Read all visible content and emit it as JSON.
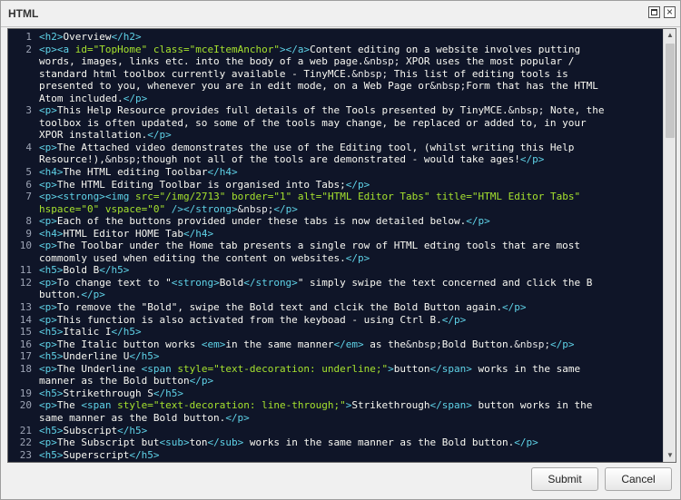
{
  "window": {
    "title": "HTML",
    "maximize_icon": "maximize-icon",
    "close_glyph": "×"
  },
  "buttons": {
    "submit": "Submit",
    "cancel": "Cancel"
  },
  "scrollbar": {
    "up": "▲",
    "down": "▼"
  },
  "code_lines": [
    {
      "n": "1",
      "seg": [
        [
          "t",
          "<h2>"
        ],
        [
          "x",
          "Overview"
        ],
        [
          "t",
          "</h2>"
        ]
      ]
    },
    {
      "n": "2",
      "seg": [
        [
          "t",
          "<p>"
        ],
        [
          "t",
          "<a "
        ],
        [
          "a",
          "id="
        ],
        [
          "v",
          "\"TopHome\""
        ],
        [
          "t",
          " "
        ],
        [
          "a",
          "class="
        ],
        [
          "v",
          "\"mceItemAnchor\""
        ],
        [
          "t",
          "></a>"
        ],
        [
          "x",
          "Content editing on a website involves putting"
        ]
      ]
    },
    {
      "n": "",
      "seg": [
        [
          "x",
          "words, images, links etc. into the body of a web page."
        ],
        [
          "e",
          "&nbsp;"
        ],
        [
          "x",
          " XPOR uses the most popular /"
        ]
      ]
    },
    {
      "n": "",
      "seg": [
        [
          "x",
          "standard html toolbox currently available - TinyMCE."
        ],
        [
          "e",
          "&nbsp;"
        ],
        [
          "x",
          " This list of editing tools is"
        ]
      ]
    },
    {
      "n": "",
      "seg": [
        [
          "x",
          "presented to you, whenever you are in edit mode, on a Web Page or"
        ],
        [
          "e",
          "&nbsp;"
        ],
        [
          "x",
          "Form that has the HTML"
        ]
      ]
    },
    {
      "n": "",
      "seg": [
        [
          "x",
          "Atom included."
        ],
        [
          "t",
          "</p>"
        ]
      ]
    },
    {
      "n": "3",
      "seg": [
        [
          "t",
          "<p>"
        ],
        [
          "x",
          "This Help Resource provides full details of the Tools presented by TinyMCE."
        ],
        [
          "e",
          "&nbsp;"
        ],
        [
          "x",
          " Note, the"
        ]
      ]
    },
    {
      "n": "",
      "seg": [
        [
          "x",
          "toolbox is often updated, so some of the tools may change, be replaced or added to, in your"
        ]
      ]
    },
    {
      "n": "",
      "seg": [
        [
          "x",
          "XPOR installation."
        ],
        [
          "t",
          "</p>"
        ]
      ]
    },
    {
      "n": "4",
      "seg": [
        [
          "t",
          "<p>"
        ],
        [
          "x",
          "The Attached video demonstrates the use of the Editing tool, (whilst writing this Help"
        ]
      ]
    },
    {
      "n": "",
      "seg": [
        [
          "x",
          "Resource!),"
        ],
        [
          "e",
          "&nbsp;"
        ],
        [
          "x",
          "though not all of the tools are demonstrated - would take ages!"
        ],
        [
          "t",
          "</p>"
        ]
      ]
    },
    {
      "n": "5",
      "seg": [
        [
          "t",
          "<h4>"
        ],
        [
          "x",
          "The HTML editing Toolbar"
        ],
        [
          "t",
          "</h4>"
        ]
      ]
    },
    {
      "n": "6",
      "seg": [
        [
          "t",
          "<p>"
        ],
        [
          "x",
          "The HTML Editing Toolbar is organised into Tabs;"
        ],
        [
          "t",
          "</p>"
        ]
      ]
    },
    {
      "n": "7",
      "seg": [
        [
          "t",
          "<p>"
        ],
        [
          "t",
          "<strong>"
        ],
        [
          "t",
          "<img "
        ],
        [
          "a",
          "src="
        ],
        [
          "v",
          "\"/img/2713\""
        ],
        [
          "t",
          " "
        ],
        [
          "a",
          "border="
        ],
        [
          "v",
          "\"1\""
        ],
        [
          "t",
          " "
        ],
        [
          "a",
          "alt="
        ],
        [
          "v",
          "\"HTML Editor Tabs\""
        ],
        [
          "t",
          " "
        ],
        [
          "a",
          "title="
        ],
        [
          "v",
          "\"HTML Editor Tabs\""
        ]
      ]
    },
    {
      "n": "",
      "seg": [
        [
          "a",
          "hspace="
        ],
        [
          "v",
          "\"0\""
        ],
        [
          "t",
          " "
        ],
        [
          "a",
          "vspace="
        ],
        [
          "v",
          "\"0\""
        ],
        [
          "t",
          " />"
        ],
        [
          "t",
          "</strong>"
        ],
        [
          "e",
          "&nbsp;"
        ],
        [
          "t",
          "</p>"
        ]
      ]
    },
    {
      "n": "8",
      "seg": [
        [
          "t",
          "<p>"
        ],
        [
          "x",
          "Each of the buttons provided under these tabs is now detailed below."
        ],
        [
          "t",
          "</p>"
        ]
      ]
    },
    {
      "n": "9",
      "seg": [
        [
          "t",
          "<h4>"
        ],
        [
          "x",
          "HTML Editor HOME Tab"
        ],
        [
          "t",
          "</h4>"
        ]
      ]
    },
    {
      "n": "10",
      "seg": [
        [
          "t",
          "<p>"
        ],
        [
          "x",
          "The Toolbar under the Home tab presents a single row of HTML edting tools that are most"
        ]
      ]
    },
    {
      "n": "",
      "seg": [
        [
          "x",
          "commomly used when editing the content on websites."
        ],
        [
          "t",
          "</p>"
        ]
      ]
    },
    {
      "n": "11",
      "seg": [
        [
          "t",
          "<h5>"
        ],
        [
          "x",
          "Bold B"
        ],
        [
          "t",
          "</h5>"
        ]
      ]
    },
    {
      "n": "12",
      "seg": [
        [
          "t",
          "<p>"
        ],
        [
          "x",
          "To change text to \""
        ],
        [
          "t",
          "<strong>"
        ],
        [
          "x",
          "Bold"
        ],
        [
          "t",
          "</strong>"
        ],
        [
          "x",
          "\" simply swipe the text concerned and click the B"
        ]
      ]
    },
    {
      "n": "",
      "seg": [
        [
          "x",
          "button."
        ],
        [
          "t",
          "</p>"
        ]
      ]
    },
    {
      "n": "13",
      "seg": [
        [
          "t",
          "<p>"
        ],
        [
          "x",
          "To remove the \"Bold\", swipe the Bold text and clcik the Bold Button again."
        ],
        [
          "t",
          "</p>"
        ]
      ]
    },
    {
      "n": "14",
      "seg": [
        [
          "t",
          "<p>"
        ],
        [
          "x",
          "This function is also activated from the keyboad - using Ctrl B."
        ],
        [
          "t",
          "</p>"
        ]
      ]
    },
    {
      "n": "15",
      "seg": [
        [
          "t",
          "<h5>"
        ],
        [
          "x",
          "Italic I"
        ],
        [
          "t",
          "</h5>"
        ]
      ]
    },
    {
      "n": "16",
      "seg": [
        [
          "t",
          "<p>"
        ],
        [
          "x",
          "The Italic button works "
        ],
        [
          "t",
          "<em>"
        ],
        [
          "x",
          "in the same manner"
        ],
        [
          "t",
          "</em>"
        ],
        [
          "x",
          " as the"
        ],
        [
          "e",
          "&nbsp;"
        ],
        [
          "x",
          "Bold Button."
        ],
        [
          "e",
          "&nbsp;"
        ],
        [
          "t",
          "</p>"
        ]
      ]
    },
    {
      "n": "17",
      "seg": [
        [
          "t",
          "<h5>"
        ],
        [
          "x",
          "Underline U"
        ],
        [
          "t",
          "</h5>"
        ]
      ]
    },
    {
      "n": "18",
      "seg": [
        [
          "t",
          "<p>"
        ],
        [
          "x",
          "The Underline "
        ],
        [
          "t",
          "<span "
        ],
        [
          "a",
          "style="
        ],
        [
          "v",
          "\"text-decoration: underline;\""
        ],
        [
          "t",
          ">"
        ],
        [
          "x",
          "button"
        ],
        [
          "t",
          "</span>"
        ],
        [
          "x",
          " works in the same"
        ]
      ]
    },
    {
      "n": "",
      "seg": [
        [
          "x",
          "manner as the Bold button"
        ],
        [
          "t",
          "</p>"
        ]
      ]
    },
    {
      "n": "19",
      "seg": [
        [
          "t",
          "<h5>"
        ],
        [
          "x",
          "Strikethrough S"
        ],
        [
          "t",
          "</h5>"
        ]
      ]
    },
    {
      "n": "20",
      "seg": [
        [
          "t",
          "<p>"
        ],
        [
          "x",
          "The "
        ],
        [
          "t",
          "<span "
        ],
        [
          "a",
          "style="
        ],
        [
          "v",
          "\"text-decoration: line-through;\""
        ],
        [
          "t",
          ">"
        ],
        [
          "x",
          "Strikethrough"
        ],
        [
          "t",
          "</span>"
        ],
        [
          "x",
          " button works in the"
        ]
      ]
    },
    {
      "n": "",
      "seg": [
        [
          "x",
          "same manner as the Bold button."
        ],
        [
          "t",
          "</p>"
        ]
      ]
    },
    {
      "n": "21",
      "seg": [
        [
          "t",
          "<h5>"
        ],
        [
          "x",
          "Subscript"
        ],
        [
          "t",
          "</h5>"
        ]
      ]
    },
    {
      "n": "22",
      "seg": [
        [
          "t",
          "<p>"
        ],
        [
          "x",
          "The Subscript but"
        ],
        [
          "t",
          "<sub>"
        ],
        [
          "x",
          "ton"
        ],
        [
          "t",
          "</sub>"
        ],
        [
          "x",
          " works in the same manner as the Bold button."
        ],
        [
          "t",
          "</p>"
        ]
      ]
    },
    {
      "n": "23",
      "seg": [
        [
          "t",
          "<h5>"
        ],
        [
          "x",
          "Superscript"
        ],
        [
          "t",
          "</h5>"
        ]
      ]
    }
  ]
}
